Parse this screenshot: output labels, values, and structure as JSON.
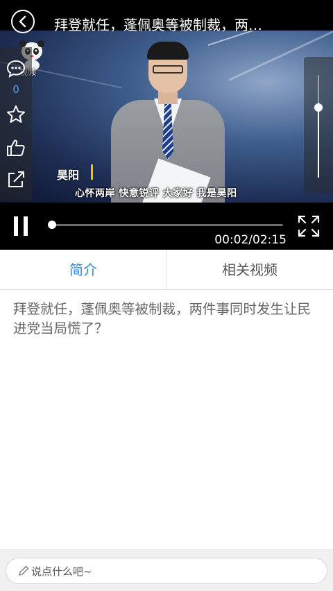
{
  "header": {
    "title": "拜登就任，蓬佩奥等被制裁，两…",
    "back_icon": "chevron-left-icon"
  },
  "watermark": {
    "text": "视频",
    "logo_icon": "panda-logo-icon"
  },
  "video": {
    "anchor_name": "昊阳",
    "caption": "心怀两岸  快意锐评  大家好  我是昊阳"
  },
  "side_actions": {
    "comment_icon": "comment-icon",
    "comment_count": "0",
    "favorite_icon": "star-icon",
    "like_icon": "thumbs-up-icon",
    "share_icon": "share-icon"
  },
  "player": {
    "state": "playing",
    "current_time": "00:02",
    "total_time": "02:15",
    "time_display": "00:02/02:15",
    "progress": 0.015,
    "volume": 0.68,
    "pause_icon": "pause-icon",
    "fullscreen_icon": "fullscreen-icon"
  },
  "tabs": [
    {
      "label": "简介",
      "active": true
    },
    {
      "label": "相关视频",
      "active": false
    }
  ],
  "intro": {
    "text": "拜登就任，蓬佩奥等被制裁，两件事同时发生让民进党当局慌了？"
  },
  "comment": {
    "placeholder": "说点什么吧~",
    "icon": "pencil-icon"
  },
  "colors": {
    "accent": "#2a8be6",
    "count": "#4ea3ff",
    "name_bar": "#f2c200"
  }
}
